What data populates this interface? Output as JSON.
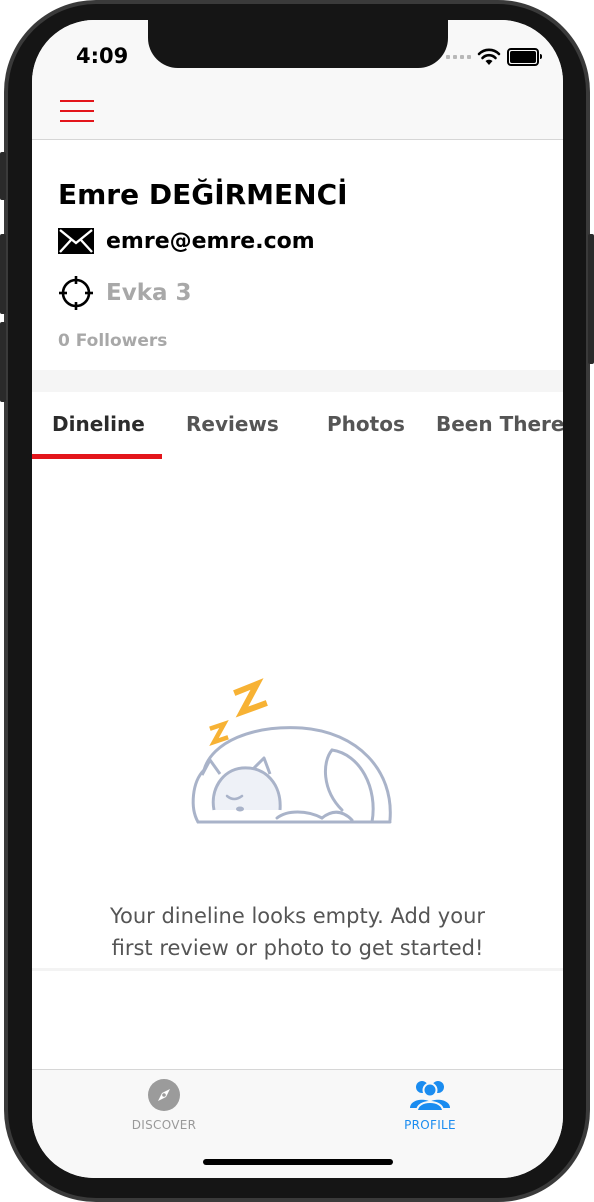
{
  "status_bar": {
    "time": "4:09"
  },
  "profile": {
    "name": "Emre DEĞİRMENCİ",
    "email": "emre@emre.com",
    "location": "Evka 3",
    "followers": "0 Followers"
  },
  "tabs": [
    {
      "label": "Dineline",
      "active": true
    },
    {
      "label": "Reviews",
      "active": false
    },
    {
      "label": "Photos",
      "active": false
    },
    {
      "label": "Been There",
      "active": false
    }
  ],
  "empty_state": {
    "line1": "Your dineline looks empty. Add your",
    "line2": "first review or photo to get started!"
  },
  "tab_bar": {
    "discover": "DISCOVER",
    "profile": "PROFILE"
  },
  "colors": {
    "accent": "#e3151b",
    "active_tab_bar": "#1a8cf0",
    "inactive_text": "#a8a8a8",
    "sleep_z": "#f7b234",
    "illustration_line": "#a9b3c9"
  }
}
